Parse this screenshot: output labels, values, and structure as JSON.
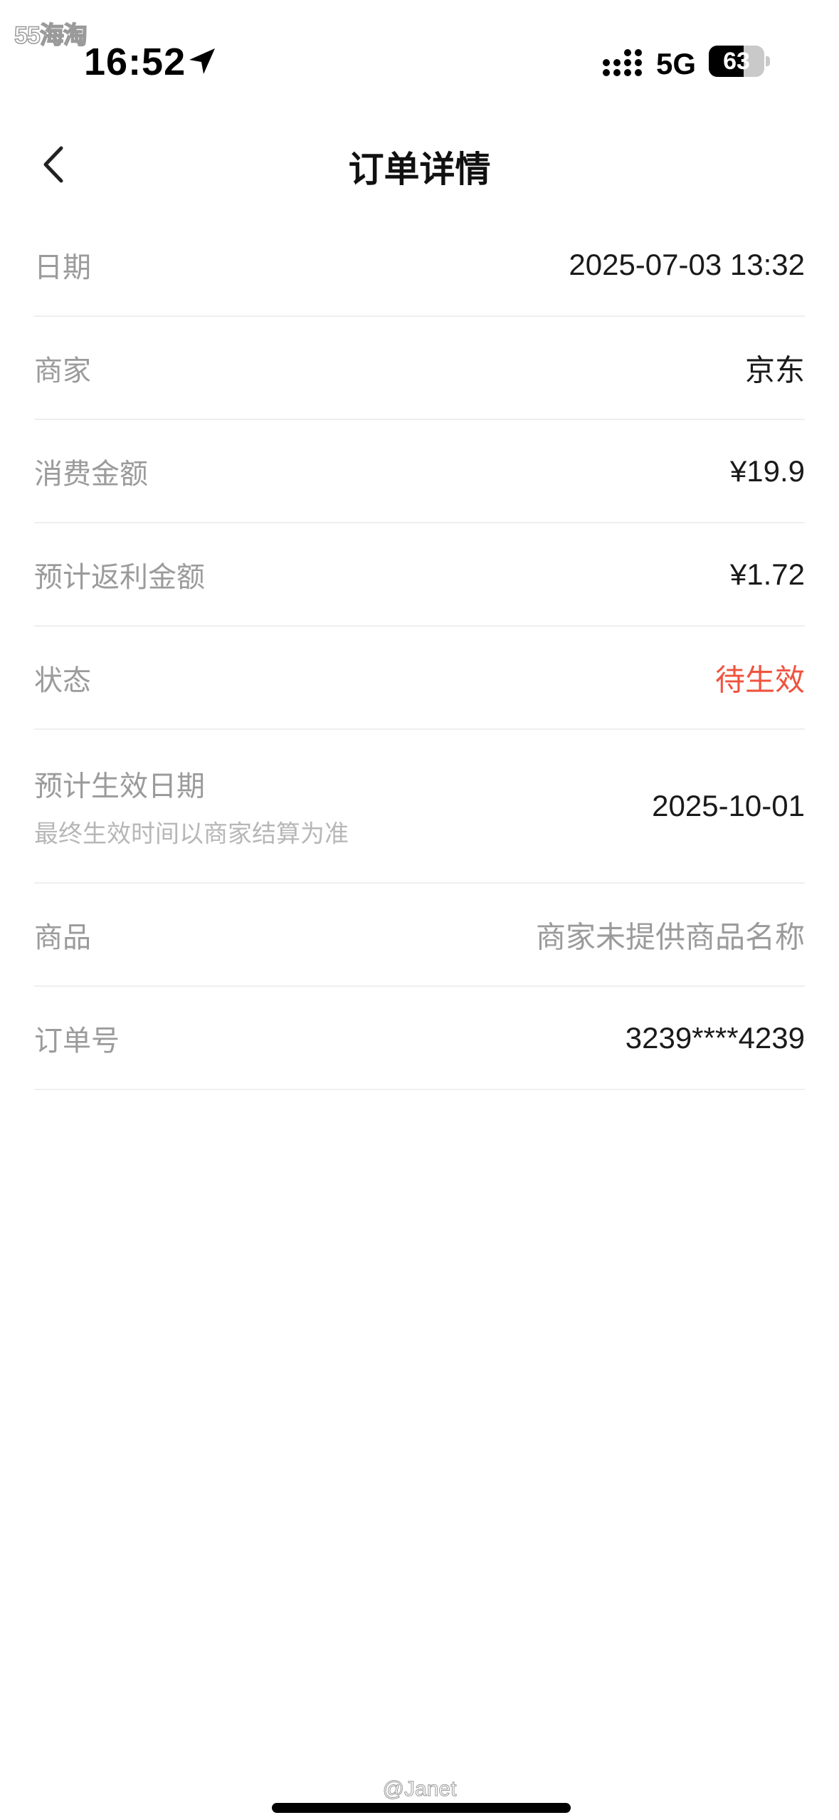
{
  "watermark": {
    "top": "55海淘",
    "bottom": "@Janet"
  },
  "status_bar": {
    "time": "16:52",
    "network": "5G",
    "battery": "63",
    "battery_level": 0.63
  },
  "nav": {
    "title": "订单详情",
    "back_icon": "chevron-left-icon"
  },
  "rows": [
    {
      "label": "日期",
      "value": "2025-07-03 13:32"
    },
    {
      "label": "商家",
      "value": "京东"
    },
    {
      "label": "消费金额",
      "value": "¥19.9"
    },
    {
      "label": "预计返利金额",
      "value": "¥1.72"
    },
    {
      "label": "状态",
      "value": "待生效"
    },
    {
      "label": "预计生效日期",
      "sublabel": "最终生效时间以商家结算为准",
      "value": "2025-10-01"
    },
    {
      "label": "商品",
      "value": "商家未提供商品名称"
    },
    {
      "label": "订单号",
      "value": "3239****4239"
    }
  ],
  "colors": {
    "status_pending": "#f0533e",
    "label_gray": "#9b9b9b",
    "divider": "#efefef"
  }
}
